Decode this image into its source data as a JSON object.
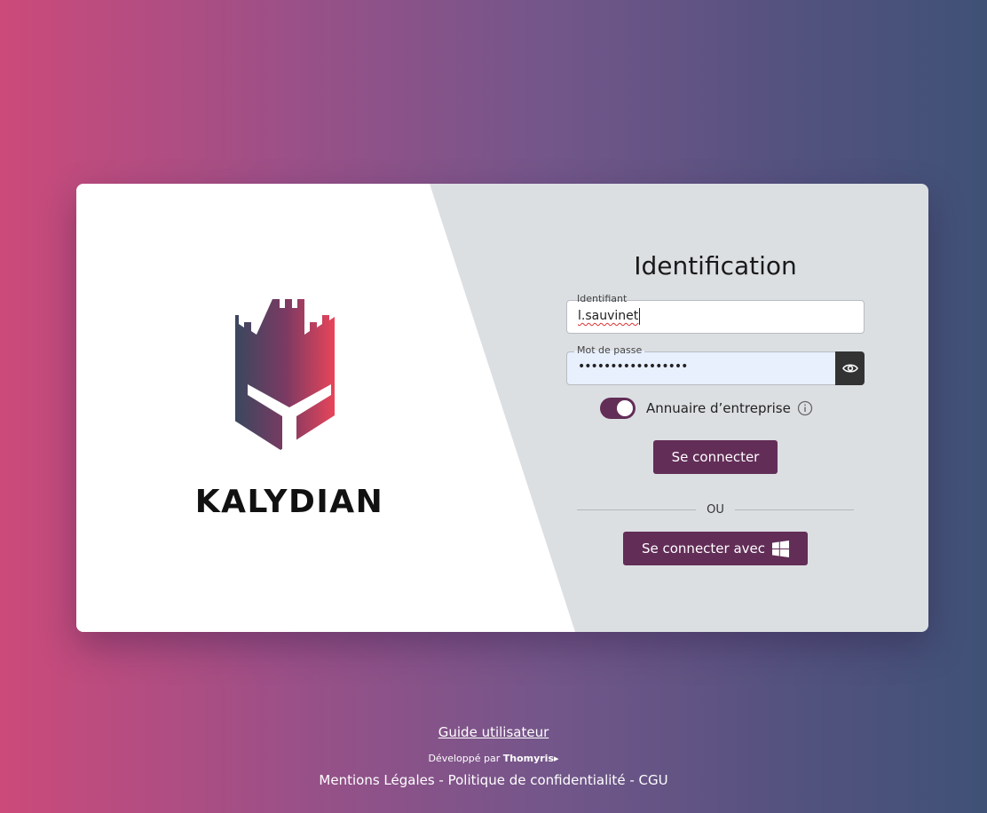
{
  "brand": {
    "name": "KALYDIAN"
  },
  "form": {
    "title": "Identification",
    "username": {
      "label": "Identifiant",
      "value": "l.sauvinet"
    },
    "password": {
      "label": "Mot de passe",
      "masked_value": "•••••••••••••••••"
    },
    "directory_toggle": {
      "label": "Annuaire d’entreprise",
      "checked": true
    },
    "login_button": "Se connecter",
    "divider": "OU",
    "sso_button": "Se connecter avec"
  },
  "footer": {
    "guide": "Guide utilisateur",
    "developed_by": "Développé par",
    "developer": "Thomyris",
    "legal": "Mentions Légales - Politique de confidentialité - CGU"
  },
  "colors": {
    "accent": "#622d57",
    "panel": "#dcdfe2"
  }
}
